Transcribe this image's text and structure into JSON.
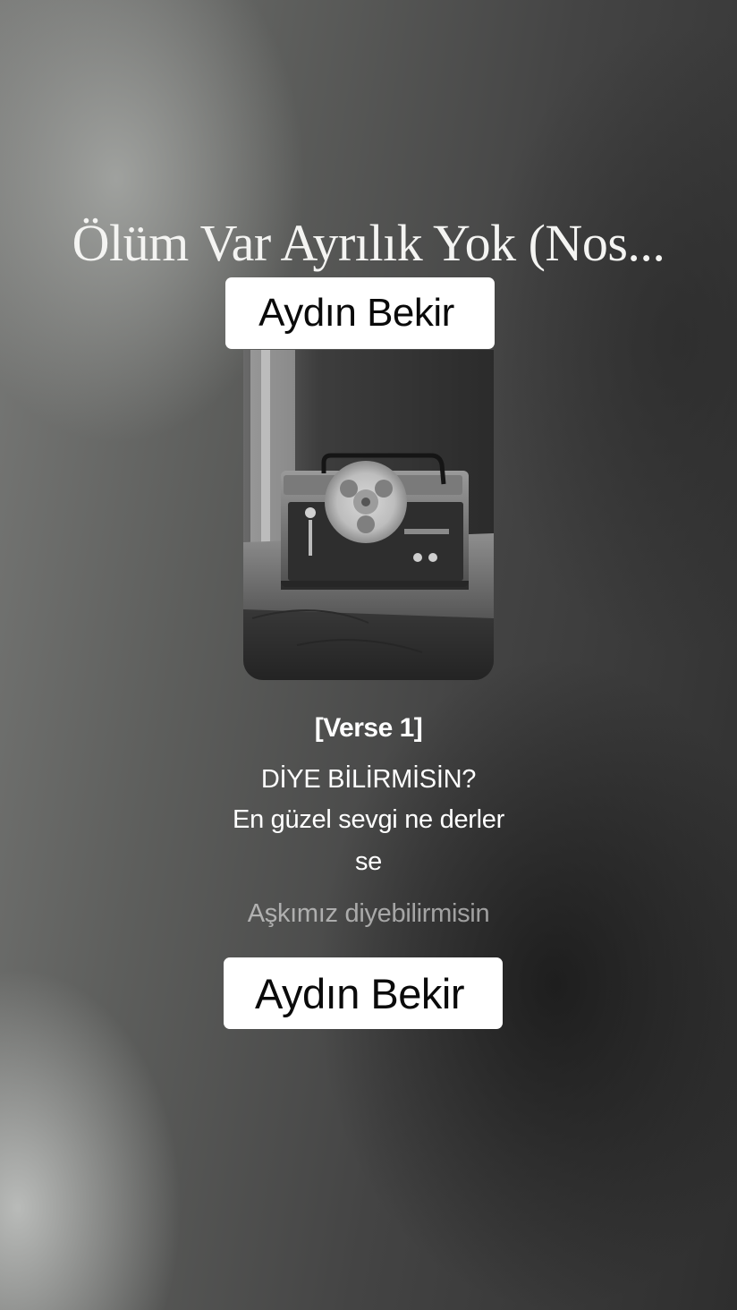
{
  "song": {
    "title": "Ölüm Var Ayrılık Yok (Nos...",
    "artist_top": "Aydın Bekir",
    "artist_bottom": "Aydın Bekir"
  },
  "cover": {
    "subject": "reel-to-reel tape recorder photo",
    "icon": "cover-art-image"
  },
  "lyrics": {
    "section": "[Verse 1]",
    "lines": [
      "DİYE BİLİRMİSİN?",
      "En güzel sevgi ne derler",
      "se",
      "Aşkımız diyebilirmisin"
    ]
  },
  "colors": {
    "badge_background": "#ffffff",
    "badge_text": "#0a0a0a",
    "lyric_active": "#ffffff",
    "lyric_upcoming": "rgba(255,255,255,0.55)"
  }
}
